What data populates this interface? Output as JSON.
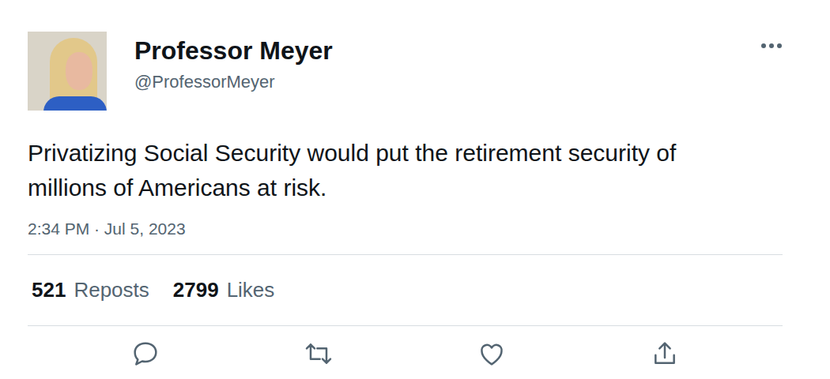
{
  "user": {
    "name": "Professor Meyer",
    "handle": "@ProfessorMeyer"
  },
  "tweet": {
    "text": "Privatizing Social Security would put the retirement security of millions of Americans at risk.",
    "timestamp": "2:34 PM · Jul 5, 2023"
  },
  "stats": [
    {
      "count": "521",
      "label": "Reposts"
    },
    {
      "count": "2799",
      "label": "Likes"
    }
  ]
}
